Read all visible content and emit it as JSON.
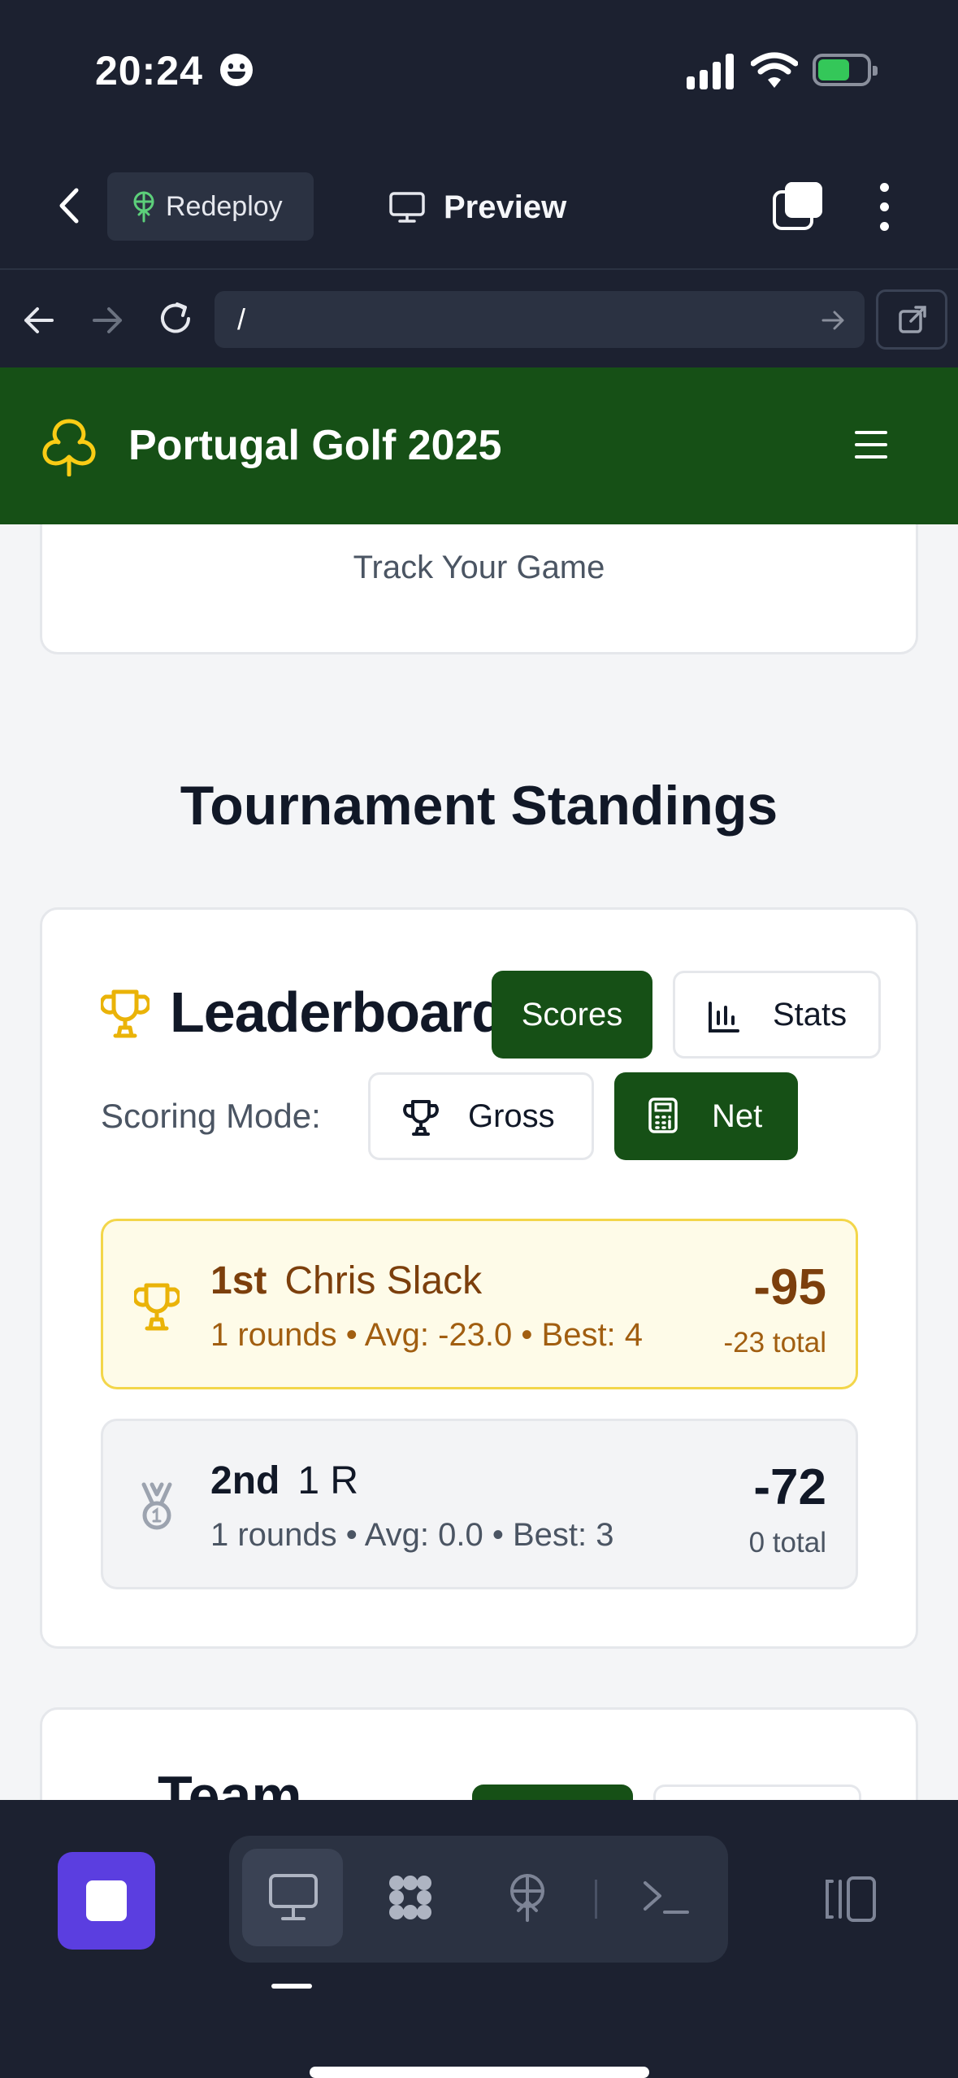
{
  "status_bar": {
    "time": "20:24"
  },
  "ide": {
    "redeploy_label": "Redeploy",
    "preview_label": "Preview",
    "url": "/"
  },
  "app": {
    "title": "Portugal Golf 2025",
    "hero_subtitle": "Track Your Game",
    "section_title": "Tournament Standings"
  },
  "leaderboard": {
    "title": "Leaderboard",
    "scores_label": "Scores",
    "stats_label": "Stats",
    "scoring_mode_label": "Scoring Mode:",
    "gross_label": "Gross",
    "net_label": "Net",
    "selected_mode": "Net",
    "entries": [
      {
        "rank": "1st",
        "name": "Chris Slack",
        "meta": "1 rounds • Avg: -23.0 • Best: 4",
        "score": "-95",
        "total": "-23 total",
        "icon": "trophy-icon"
      },
      {
        "rank": "2nd",
        "name": "1 R",
        "meta": "1 rounds • Avg: 0.0 • Best: 3",
        "score": "-72",
        "total": "0 total",
        "icon": "medal-icon"
      }
    ]
  },
  "team": {
    "title": "Team"
  },
  "colors": {
    "brand_green": "#165016",
    "chrome_bg": "#1c2130",
    "gold": "#eab308",
    "accent_purple": "#5b3ee0"
  }
}
